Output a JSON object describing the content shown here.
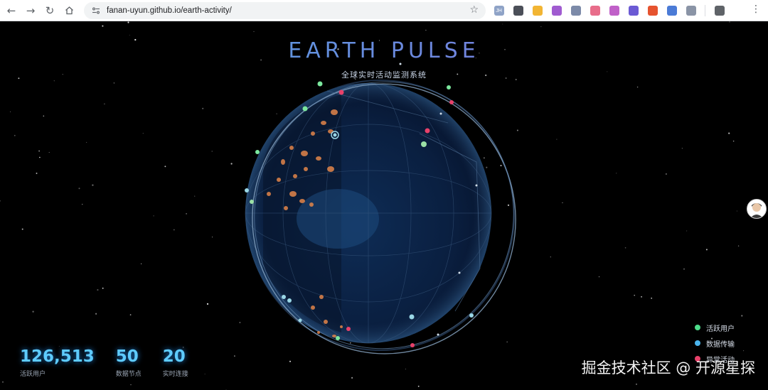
{
  "browser": {
    "url": "fanan-uyun.github.io/earth-activity/",
    "extensions": [
      {
        "name": "jh-extension-icon",
        "label": "JH",
        "color": "#8fa3c7"
      },
      {
        "name": "elephant-extension-icon",
        "label": "",
        "color": "#4b4f58"
      },
      {
        "name": "download-extension-icon",
        "label": "",
        "color": "#f2b533"
      },
      {
        "name": "pen-extension-icon",
        "label": "",
        "color": "#a05bd0"
      },
      {
        "name": "scissors-extension-icon",
        "label": "",
        "color": "#7c8aa8"
      },
      {
        "name": "chart-extension-icon",
        "label": "",
        "color": "#e86d8a"
      },
      {
        "name": "brain-extension-icon",
        "label": "",
        "color": "#c060c8"
      },
      {
        "name": "bookmark-extension-icon",
        "label": "",
        "color": "#6b5ad4"
      },
      {
        "name": "translate-extension-icon",
        "label": "",
        "color": "#e6532f"
      },
      {
        "name": "cart-extension-icon",
        "label": "",
        "color": "#4b7bd6"
      },
      {
        "name": "feather-extension-icon",
        "label": "",
        "color": "#8a94a6"
      },
      {
        "name": "puzzle-extension-icon",
        "label": "",
        "color": "#5f6368"
      }
    ]
  },
  "page": {
    "title": "EARTH PULSE",
    "subtitle": "全球实时活动监测系统"
  },
  "stats": [
    {
      "value": "126,513",
      "label": "活跃用户"
    },
    {
      "value": "50",
      "label": "数据节点"
    },
    {
      "value": "20",
      "label": "实时连接"
    }
  ],
  "legend": [
    {
      "label": "活跃用户",
      "color": "#4ddc8a"
    },
    {
      "label": "数据传输",
      "color": "#4ab4ec"
    },
    {
      "label": "异常活动",
      "color": "#e8416a"
    }
  ],
  "watermark": "掘金技术社区 @ 开源星探"
}
